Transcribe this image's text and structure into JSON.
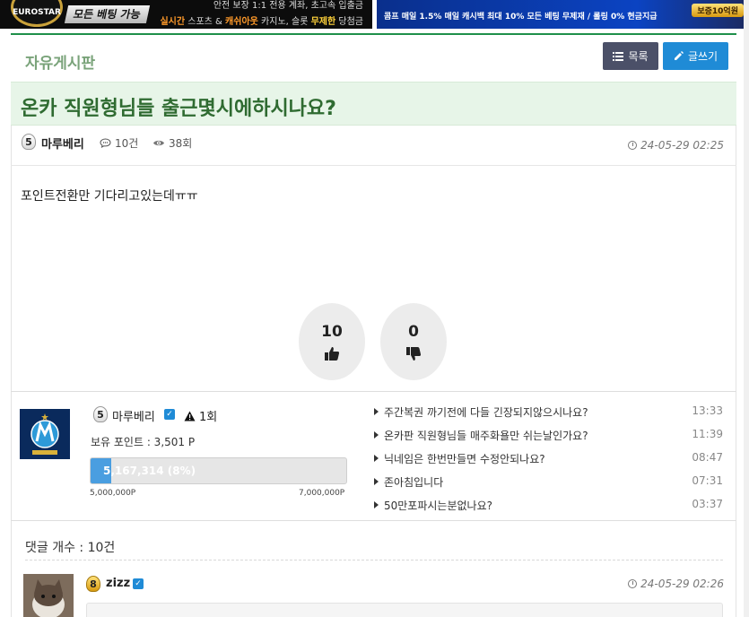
{
  "banner": {
    "left_logo": "EUROSTAR",
    "left_slogan": "모든 베팅 가능",
    "left_line1": "안전 보장 1:1 전용 계좌, 초고속 입출금",
    "left_line2_a": "실시간",
    "left_line2_b": "스포츠 &",
    "left_line2_c": "캐쉬아웃",
    "left_line2_d": "카지노, 슬롯",
    "left_line2_e": "무제한",
    "left_line2_f": "당첨금",
    "right_promo": "콤프 매일 1.5% 매일 캐시백 최대 10% 모든 베팅 무제재 / 롤링 0% 현금지급",
    "right_stamp": "보증10억원"
  },
  "board": {
    "title": "자유게시판",
    "list_button": "목록",
    "write_button": "글쓰기"
  },
  "post": {
    "title": "온카 직원형님들 출근몇시에하시나요?",
    "author_level": "5",
    "author": "마루베리",
    "comment_count": "10건",
    "views": "38회",
    "date": "24-05-29 02:25",
    "content": "포인트전환만 기다리고있는데ㅠㅠ",
    "upvotes": "10",
    "downvotes": "0"
  },
  "profile": {
    "level": "5",
    "name": "마루베리",
    "warn_count": "1회",
    "points_label": "보유 포인트 : 3,501 P",
    "progress_text": "5,167,314 (8%)",
    "progress_fraction": 0.08,
    "progress_min": "5,000,000P",
    "progress_max": "7,000,000P"
  },
  "recent_posts": [
    {
      "title": "주간복권 까기전에 다들 긴장되지않으시나요?",
      "time": "13:33"
    },
    {
      "title": "온카판 직원형님들 매주화욜만 쉬는날인가요?",
      "time": "11:39"
    },
    {
      "title": "닉네임은 한번만들면 수정안되나요?",
      "time": "08:47"
    },
    {
      "title": "존아침입니다",
      "time": "07:31"
    },
    {
      "title": "50만포파시는분없나요?",
      "time": "03:37"
    }
  ],
  "comments": {
    "count_label": "댓글 개수 : 10건",
    "first": {
      "level": "8",
      "name": "zizz",
      "date": "24-05-29 02:26"
    }
  }
}
